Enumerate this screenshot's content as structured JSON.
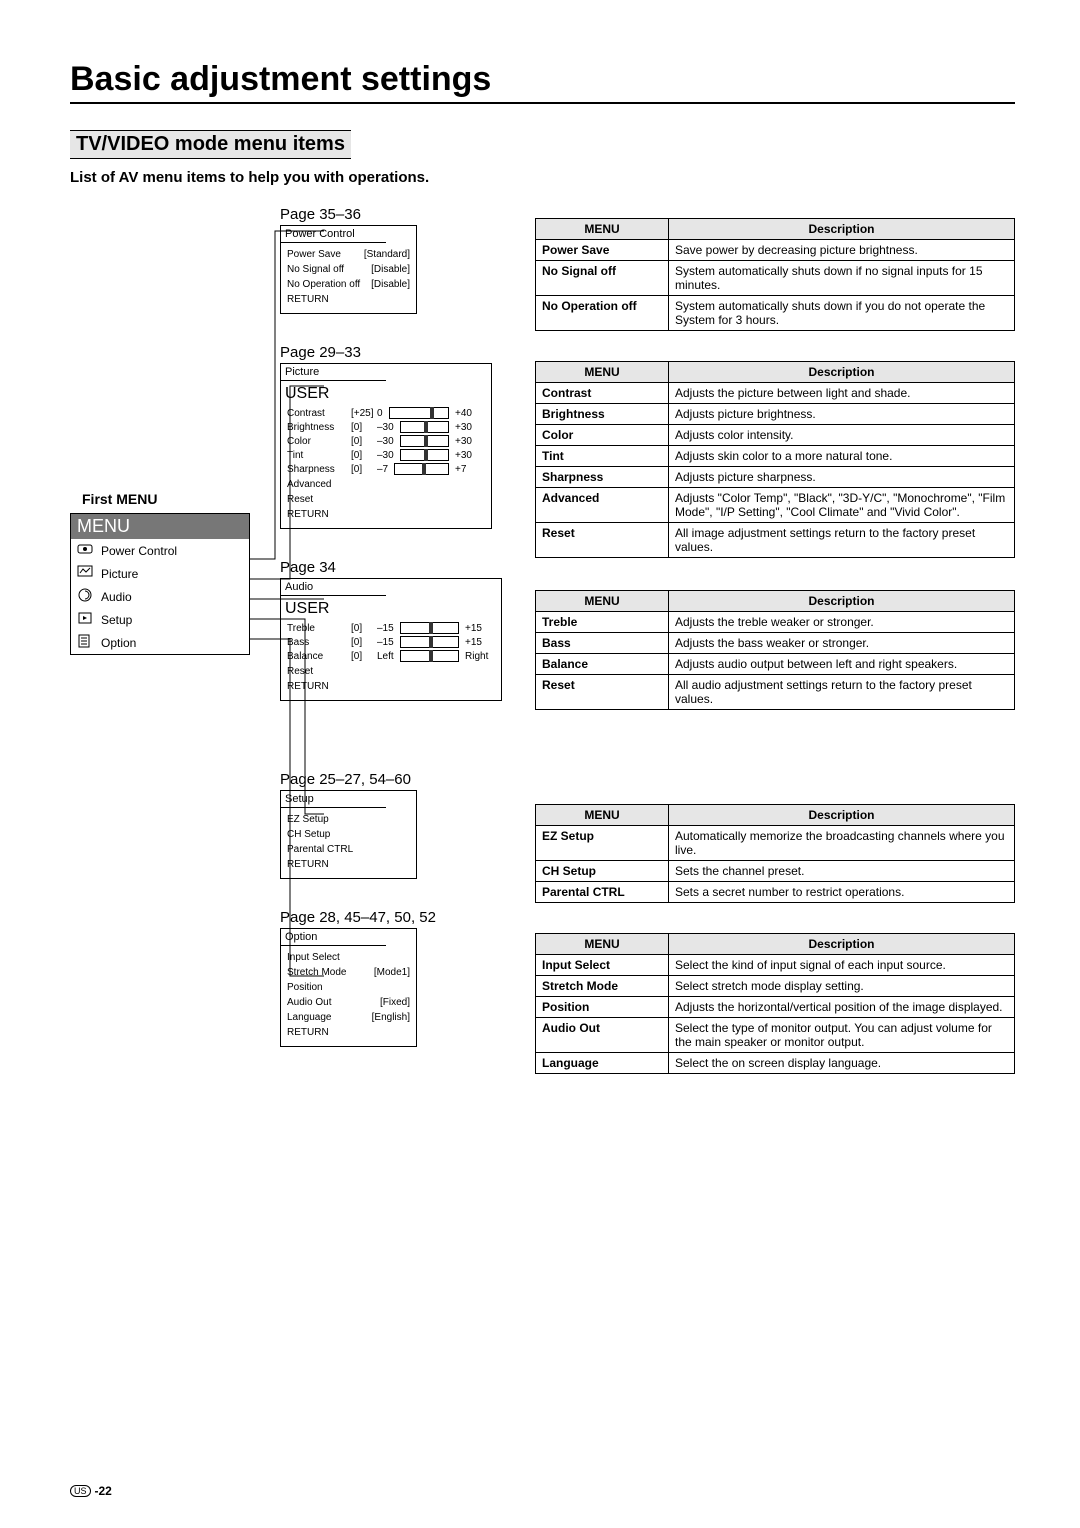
{
  "title": "Basic adjustment settings",
  "subtitle": "TV/VIDEO mode menu items",
  "intro": "List of AV menu items to help you with operations.",
  "firstMenu": {
    "label": "First MENU",
    "header": "MENU",
    "items": [
      "Power Control",
      "Picture",
      "Audio",
      "Setup",
      "Option"
    ]
  },
  "pages": {
    "power": "Page 35–36",
    "picture": "Page 29–33",
    "audio": "Page 34",
    "setup": "Page 25–27, 54–60",
    "option": "Page 28, 45–47, 50, 52"
  },
  "osd": {
    "power": {
      "title": "Power Control",
      "rows": [
        {
          "name": "Power Save",
          "value": "[Standard]"
        },
        {
          "name": "No Signal off",
          "value": "[Disable]"
        },
        {
          "name": "No Operation off",
          "value": "[Disable]"
        }
      ],
      "return": "RETURN"
    },
    "picture": {
      "title": "Picture",
      "user": "USER",
      "sliders": [
        {
          "name": "Contrast",
          "br": "[+25]",
          "low": "0",
          "high": "+40",
          "pos": 70
        },
        {
          "name": "Brightness",
          "br": "[0]",
          "low": "–30",
          "high": "+30",
          "pos": 50
        },
        {
          "name": "Color",
          "br": "[0]",
          "low": "–30",
          "high": "+30",
          "pos": 50
        },
        {
          "name": "Tint",
          "br": "[0]",
          "low": "–30",
          "high": "+30",
          "pos": 50
        },
        {
          "name": "Sharpness",
          "br": "[0]",
          "low": "–7",
          "high": "+7",
          "pos": 50
        }
      ],
      "extra": [
        "Advanced",
        "Reset"
      ],
      "return": "RETURN"
    },
    "audio": {
      "title": "Audio",
      "user": "USER",
      "sliders": [
        {
          "name": "Treble",
          "br": "[0]",
          "low": "–15",
          "high": "+15",
          "pos": 50
        },
        {
          "name": "Bass",
          "br": "[0]",
          "low": "–15",
          "high": "+15",
          "pos": 50
        },
        {
          "name": "Balance",
          "br": "[0]",
          "low": "Left",
          "high": "Right",
          "pos": 50
        }
      ],
      "extra": [
        "Reset"
      ],
      "return": "RETURN"
    },
    "setup": {
      "title": "Setup",
      "items": [
        "EZ Setup",
        "CH Setup",
        "Parental CTRL"
      ],
      "return": "RETURN"
    },
    "option": {
      "title": "Option",
      "rows": [
        {
          "name": "Input Select",
          "value": ""
        },
        {
          "name": "Stretch Mode",
          "value": "[Mode1]"
        },
        {
          "name": "Position",
          "value": ""
        },
        {
          "name": "Audio Out",
          "value": "[Fixed]"
        },
        {
          "name": "Language",
          "value": "[English]"
        }
      ],
      "return": "RETURN"
    }
  },
  "tables": {
    "headers": {
      "menu": "MENU",
      "desc": "Description"
    },
    "power": [
      {
        "m": "Power Save",
        "d": "Save power by decreasing picture brightness."
      },
      {
        "m": "No Signal off",
        "d": "System automatically shuts down if no signal inputs for 15 minutes."
      },
      {
        "m": "No Operation off",
        "d": "System automatically shuts down if you do not operate the System for 3 hours."
      }
    ],
    "picture": [
      {
        "m": "Contrast",
        "d": "Adjusts the picture between light and shade."
      },
      {
        "m": "Brightness",
        "d": "Adjusts picture brightness."
      },
      {
        "m": "Color",
        "d": "Adjusts color intensity."
      },
      {
        "m": "Tint",
        "d": "Adjusts skin color to a more natural tone."
      },
      {
        "m": "Sharpness",
        "d": "Adjusts picture sharpness."
      },
      {
        "m": "Advanced",
        "d": "Adjusts \"Color Temp\", \"Black\", \"3D-Y/C\", \"Monochrome\", \"Film Mode\", \"I/P Setting\", \"Cool Climate\" and \"Vivid Color\"."
      },
      {
        "m": "Reset",
        "d": "All image adjustment settings return to the factory preset values."
      }
    ],
    "audio": [
      {
        "m": "Treble",
        "d": "Adjusts the treble weaker or stronger."
      },
      {
        "m": "Bass",
        "d": "Adjusts the bass weaker or stronger."
      },
      {
        "m": "Balance",
        "d": "Adjusts audio output between left and right speakers."
      },
      {
        "m": "Reset",
        "d": "All audio adjustment settings return to the factory preset values."
      }
    ],
    "setup": [
      {
        "m": "EZ Setup",
        "d": "Automatically memorize the broadcasting channels where you live."
      },
      {
        "m": "CH Setup",
        "d": "Sets the channel preset."
      },
      {
        "m": "Parental CTRL",
        "d": "Sets a secret number to restrict operations."
      }
    ],
    "option": [
      {
        "m": "Input Select",
        "d": "Select the kind of input signal of each input source."
      },
      {
        "m": "Stretch Mode",
        "d": "Select stretch mode display setting."
      },
      {
        "m": "Position",
        "d": "Adjusts the horizontal/vertical position of the image displayed."
      },
      {
        "m": "Audio Out",
        "d": "Select the type of monitor output. You can adjust volume for the main speaker or monitor output."
      },
      {
        "m": "Language",
        "d": "Select the on screen display language."
      }
    ]
  },
  "footer": {
    "region": "US",
    "page": "-22"
  }
}
